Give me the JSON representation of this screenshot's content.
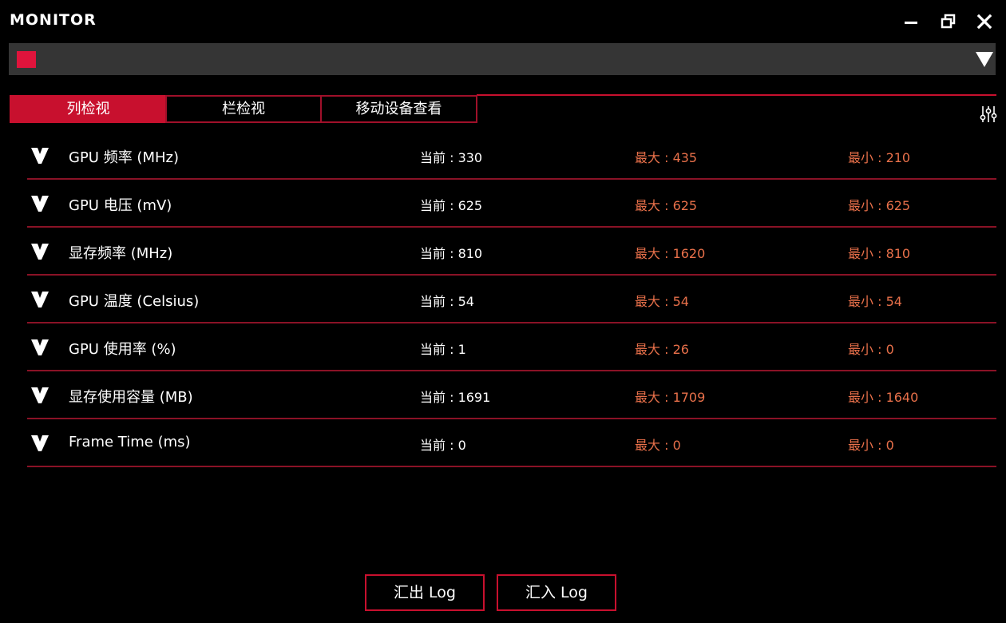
{
  "app": {
    "title": "MONITOR"
  },
  "window_controls": {
    "minimize_icon": "minimize-icon",
    "restore_icon": "restore-icon",
    "close_icon": "close-icon"
  },
  "device_bar": {
    "swatch_color": "#e0143c",
    "dropdown_icon": "triangle-down-icon"
  },
  "tabs": [
    {
      "label": "列检视",
      "active": true
    },
    {
      "label": "栏检视",
      "active": false
    },
    {
      "label": "移动设备查看",
      "active": false
    }
  ],
  "colors": {
    "accent": "#c8102e",
    "max_min_text": "#e8704a"
  },
  "metrics": [
    {
      "name": "GPU 频率 (MHz)",
      "current": "当前 : 330",
      "max": "最大 : 435",
      "min": "最小 : 210"
    },
    {
      "name": "GPU 电压 (mV)",
      "current": "当前 : 625",
      "max": "最大 : 625",
      "min": "最小 : 625"
    },
    {
      "name": "显存频率 (MHz)",
      "current": "当前 : 810",
      "max": "最大 : 1620",
      "min": "最小 : 810"
    },
    {
      "name": "GPU 温度 (Celsius)",
      "current": "当前 : 54",
      "max": "最大 : 54",
      "min": "最小 : 54"
    },
    {
      "name": "GPU 使用率 (%)",
      "current": "当前 : 1",
      "max": "最大 : 26",
      "min": "最小 : 0"
    },
    {
      "name": "显存使用容量 (MB)",
      "current": "当前 : 1691",
      "max": "最大 : 1709",
      "min": "最小 : 1640"
    },
    {
      "name": "Frame Time (ms)",
      "current": "当前 : 0",
      "max": "最大 : 0",
      "min": "最小 : 0"
    }
  ],
  "buttons": {
    "export_label": "汇出 Log",
    "import_label": "汇入 Log"
  }
}
